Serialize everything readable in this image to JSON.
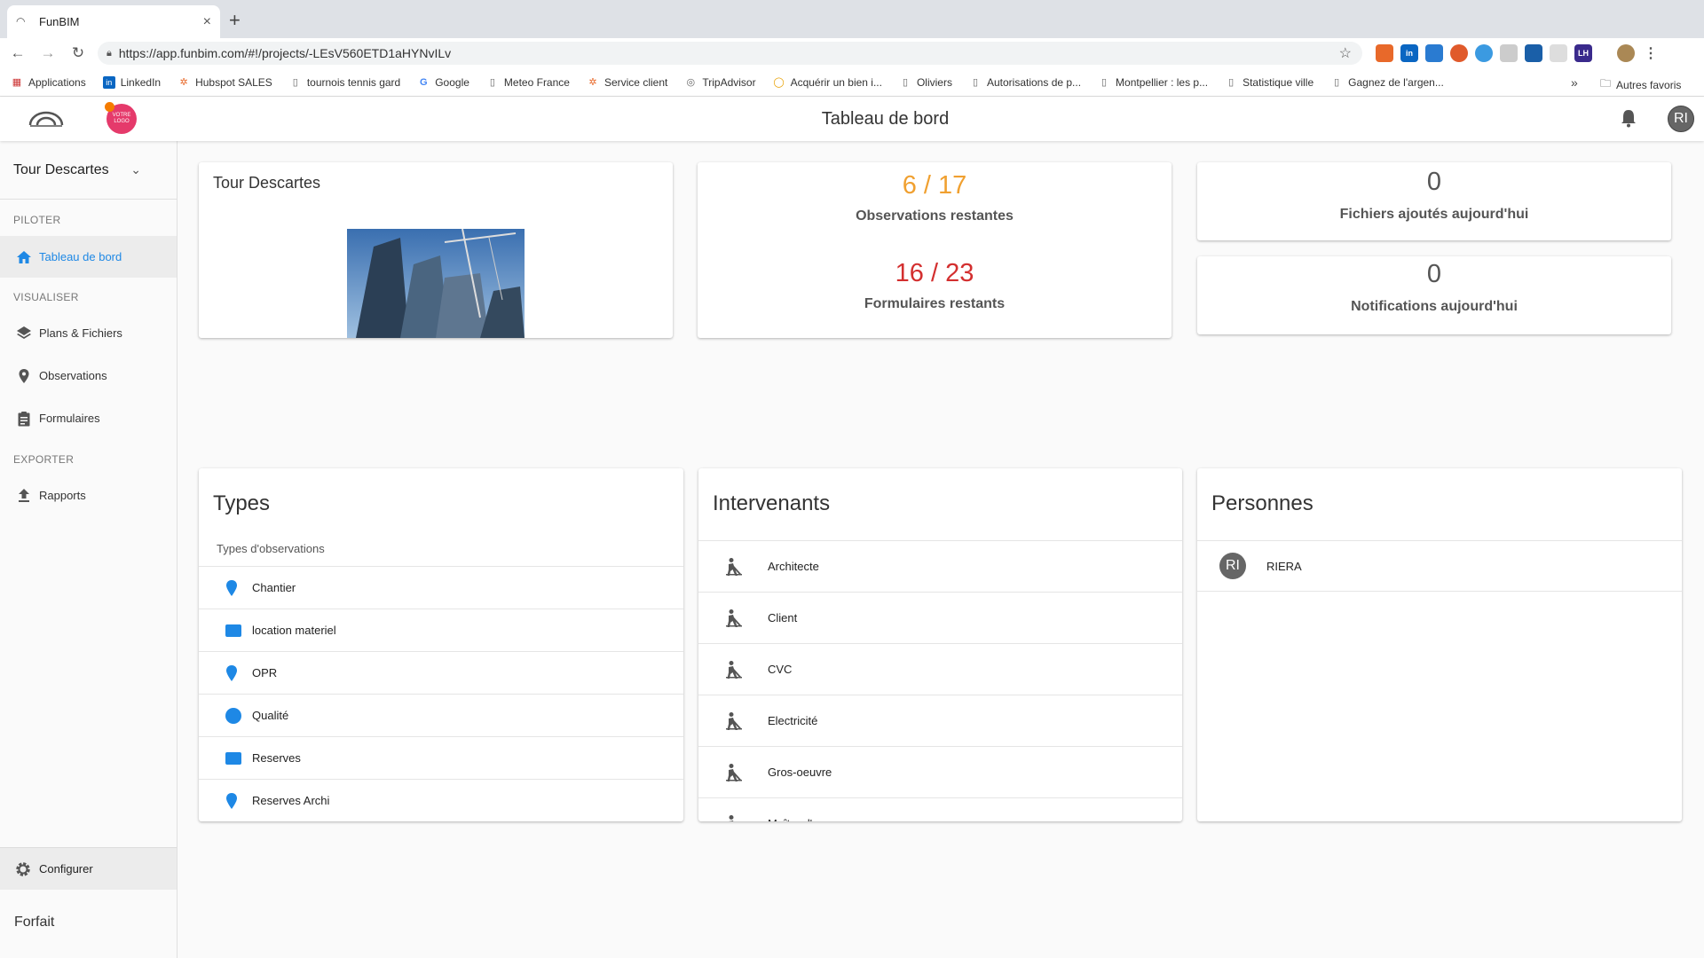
{
  "browser": {
    "tab_title": "FunBIM",
    "url": "https://app.funbim.com/#!/projects/-LEsV560ETD1aHYNvILv",
    "bookmarks": [
      "Applications",
      "LinkedIn",
      "Hubspot SALES",
      "tournois tennis gard",
      "Google",
      "Meteo France",
      "Service client",
      "TripAdvisor",
      "Acquérir un bien i...",
      "Oliviers",
      "Autorisations de p...",
      "Montpellier : les p...",
      "Statistique ville",
      "Gagnez de l'argen..."
    ],
    "other_bookmarks": "Autres favoris",
    "more": "»"
  },
  "header": {
    "title": "Tableau de bord",
    "logo_text": "VOTRE LOGO",
    "avatar_initials": "RI"
  },
  "sidebar": {
    "project": "Tour Descartes",
    "sections": {
      "piloter": "PILOTER",
      "visualiser": "VISUALISER",
      "exporter": "EXPORTER"
    },
    "items": {
      "dashboard": "Tableau de bord",
      "plans": "Plans & Fichiers",
      "observations": "Observations",
      "forms": "Formulaires",
      "reports": "Rapports"
    },
    "configure": "Configurer",
    "plan": "Forfait"
  },
  "project_card": {
    "title": "Tour Descartes"
  },
  "stats": {
    "observations_value": "6 / 17",
    "observations_label": "Observations restantes",
    "forms_value": "16 / 23",
    "forms_label": "Formulaires restants",
    "files_value": "0",
    "files_label": "Fichiers ajoutés aujourd'hui",
    "notif_value": "0",
    "notif_label": "Notifications aujourd'hui"
  },
  "types": {
    "title": "Types",
    "subtitle": "Types d'observations",
    "items": [
      {
        "label": "Chantier",
        "shape": "pin"
      },
      {
        "label": "location materiel",
        "shape": "rect"
      },
      {
        "label": "OPR",
        "shape": "pin"
      },
      {
        "label": "Qualité",
        "shape": "circle"
      },
      {
        "label": "Reserves",
        "shape": "rect"
      },
      {
        "label": "Reserves Archi",
        "shape": "pin"
      }
    ]
  },
  "intervenants": {
    "title": "Intervenants",
    "items": [
      "Architecte",
      "Client",
      "CVC",
      "Electricité",
      "Gros-oeuvre",
      "Maître d'oeuvre"
    ]
  },
  "personnes": {
    "title": "Personnes",
    "items": [
      {
        "initials": "RI",
        "name": "RIERA"
      }
    ]
  },
  "colors": {
    "accent": "#1e88e5",
    "orange": "#f0a030",
    "red": "#d32f2f"
  }
}
